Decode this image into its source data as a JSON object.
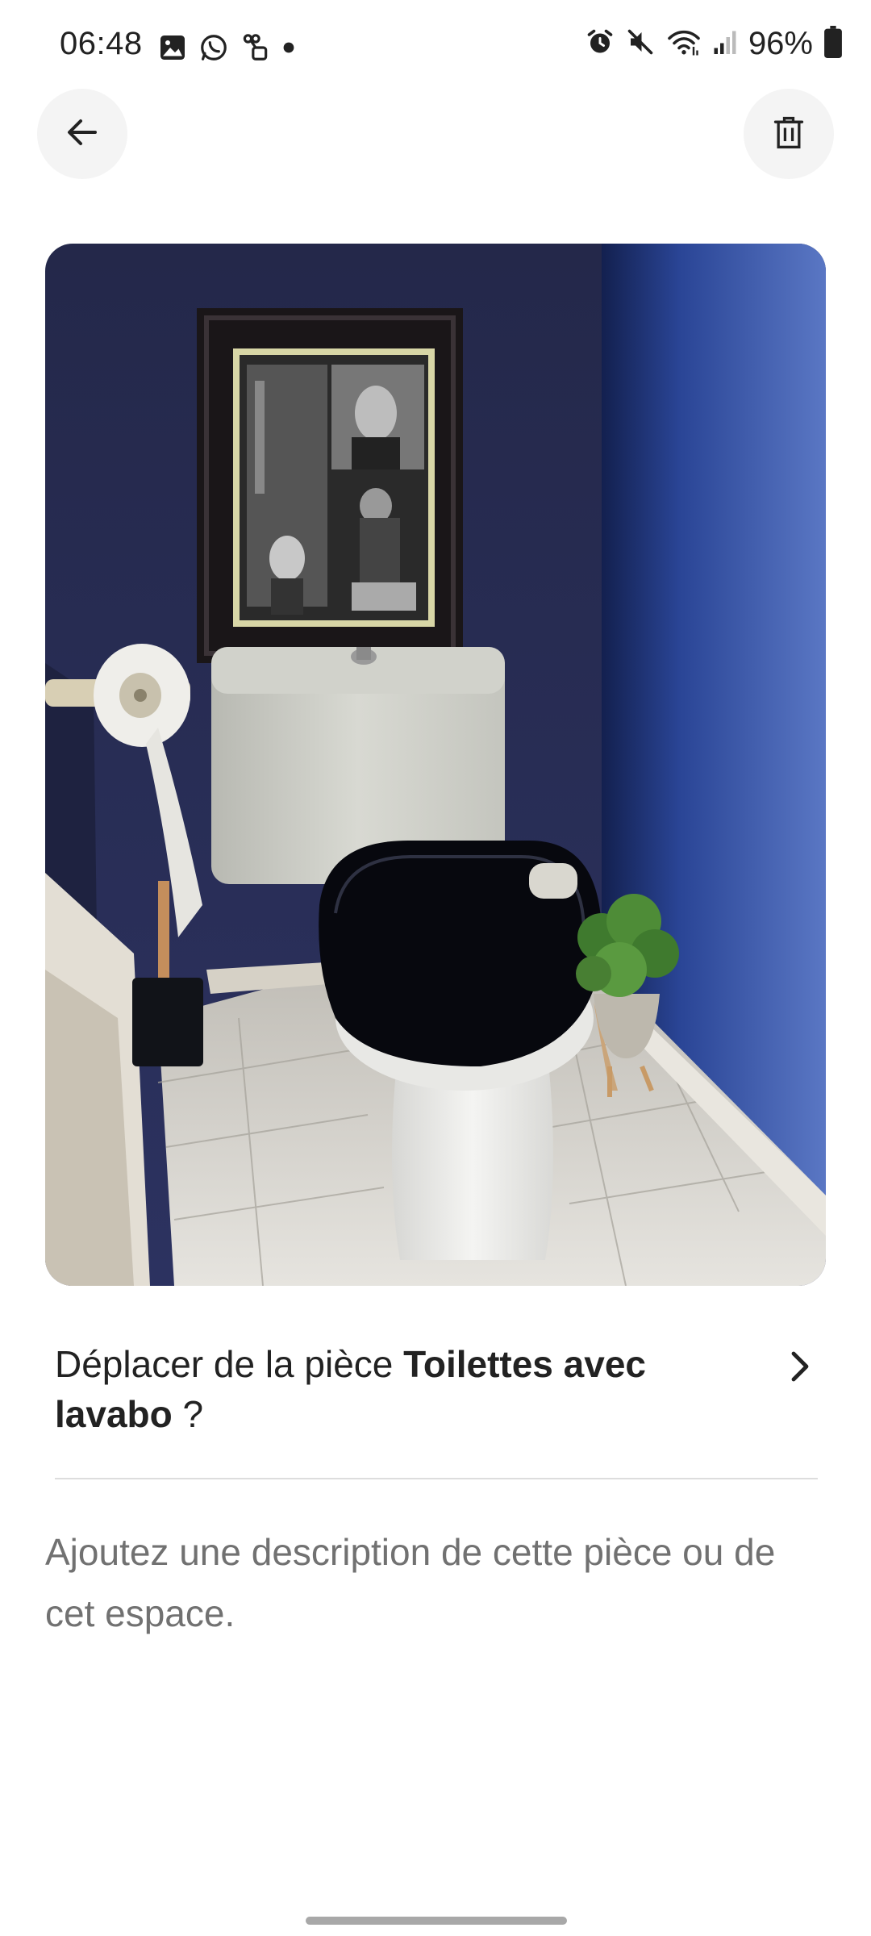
{
  "status_bar": {
    "time": "06:48",
    "battery": "96%",
    "left_icons": [
      "gallery-icon",
      "whatsapp-icon",
      "link-app-icon",
      "dot-icon"
    ],
    "right_icons": [
      "alarm-icon",
      "mute-icon",
      "wifi-icon",
      "signal-icon",
      "battery-icon"
    ]
  },
  "header": {
    "back_icon": "arrow-left-icon",
    "delete_icon": "trash-icon"
  },
  "photo": {
    "subject": "toilet-room-photo"
  },
  "move_room": {
    "prefix": "Déplacer de la pièce ",
    "room_name": "Toilettes avec lavabo",
    "suffix": " ?",
    "chevron_icon": "chevron-right-icon"
  },
  "description": {
    "placeholder": "Ajoutez une description de cette pièce ou de cet espace."
  },
  "colors": {
    "text_primary": "#222222",
    "text_secondary": "#717171",
    "button_bg": "#f4f4f4",
    "divider": "#dddddd"
  }
}
